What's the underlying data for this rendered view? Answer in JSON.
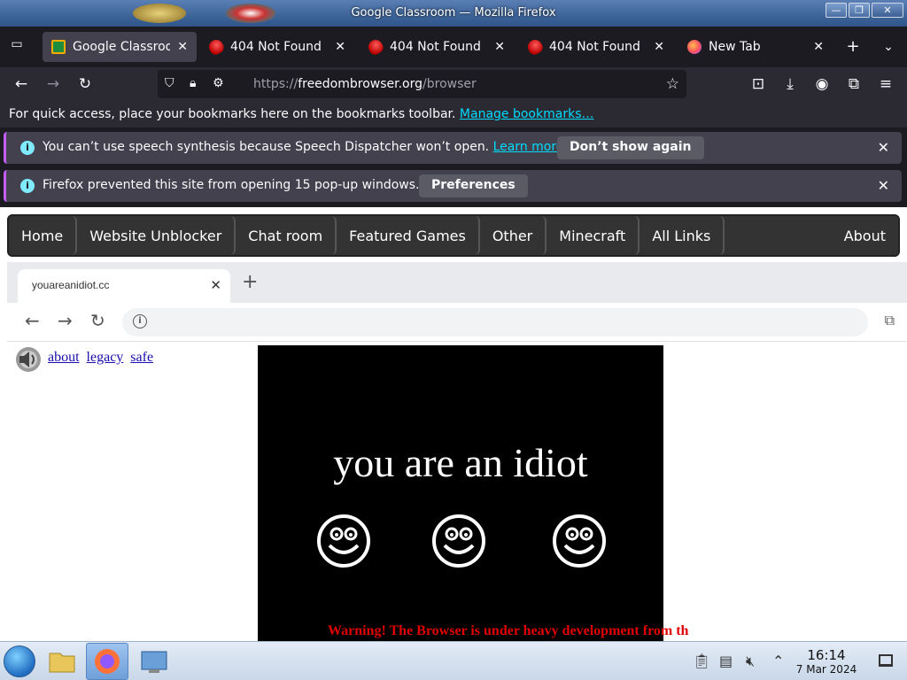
{
  "window": {
    "title": "Google Classroom — Mozilla Firefox",
    "min": "—",
    "max": "❐",
    "close": "✕"
  },
  "tabs": [
    {
      "label": "Google Classroom",
      "favicon": "classroom-icon",
      "active": true
    },
    {
      "label": "404 Not Found",
      "favicon": "rocket-icon"
    },
    {
      "label": "404 Not Found",
      "favicon": "rocket-icon"
    },
    {
      "label": "404 Not Found",
      "favicon": "rocket-icon"
    },
    {
      "label": "New Tab",
      "favicon": "firefox-icon"
    }
  ],
  "toolbar": {
    "url_proto": "https://",
    "url_host": "freedombrowser.org",
    "url_path": "/browser"
  },
  "bookmarks_bar": {
    "text": "For quick access, place your bookmarks here on the bookmarks toolbar.",
    "link": "Manage bookmarks…"
  },
  "notifications": [
    {
      "message": "You can’t use speech synthesis because Speech Dispatcher won’t open.",
      "link": "Learn more",
      "action": "Don’t show again"
    },
    {
      "message": "Firefox prevented this site from opening 15 pop-up windows.",
      "action": "Preferences"
    }
  ],
  "site_nav": [
    "Home",
    "Website Unblocker",
    "Chat room",
    "Featured Games",
    "Other",
    "Minecraft",
    "All Links"
  ],
  "site_nav_right": "About",
  "inner_browser": {
    "tab_title": "youareanidiot.cc",
    "tab_close": "✕",
    "new_tab": "+"
  },
  "page": {
    "links": [
      "about",
      "legacy",
      "safe"
    ],
    "banner_text": "you are an idiot",
    "warning": "Warning! The Browser is under heavy development from th"
  },
  "taskbar": {
    "time": "16:14",
    "date": "7 Mar 2024"
  },
  "colors": {
    "accent": "#00ddff",
    "notif_border": "#c45eff",
    "warning": "#e10000"
  }
}
